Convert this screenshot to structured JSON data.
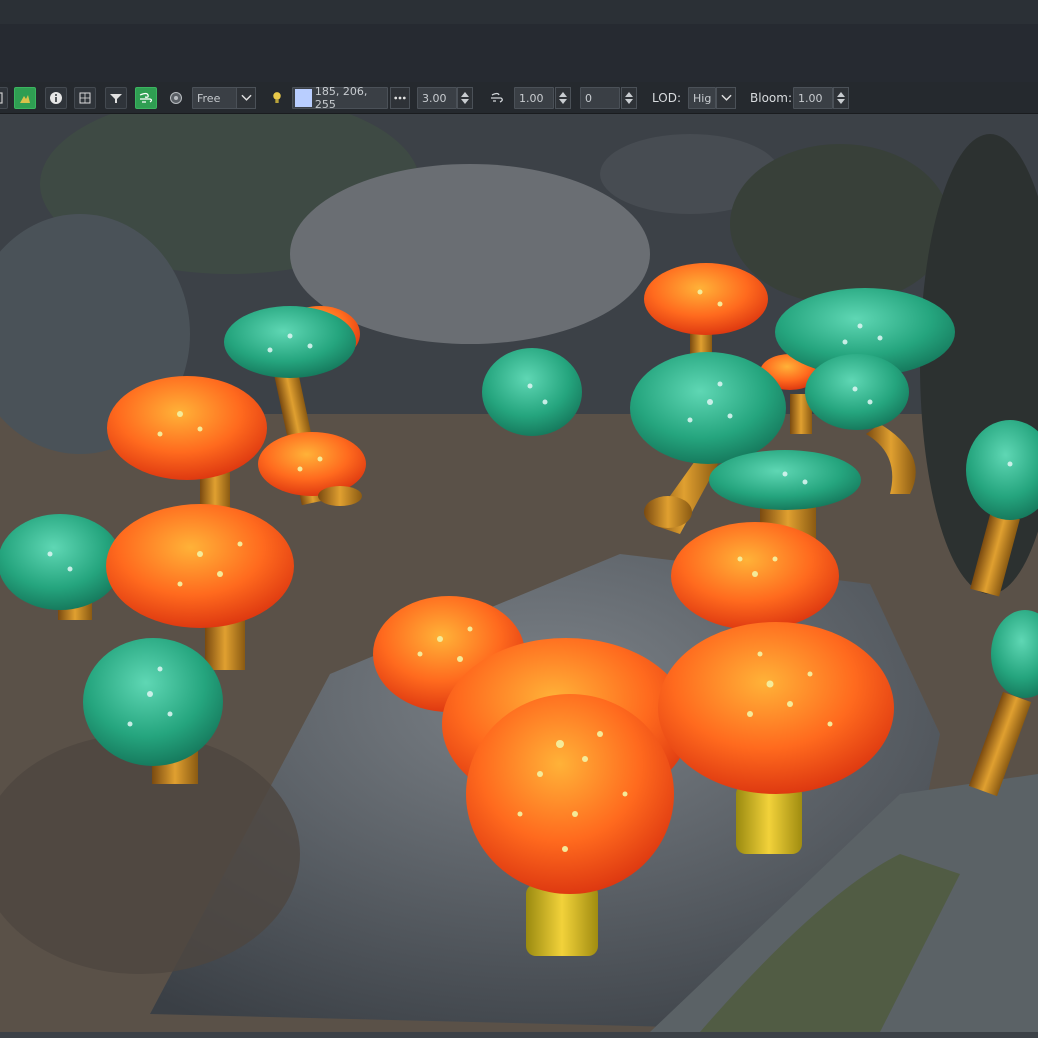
{
  "toolbar": {
    "mode_select": {
      "value": "Free"
    },
    "light_color": {
      "value": "185, 206, 255",
      "swatch": "#b9ceff"
    },
    "intensity": {
      "value": "3.00"
    },
    "wind_strength": {
      "value": "1.00"
    },
    "wind_offset": {
      "value": "0"
    },
    "lod": {
      "label": "LOD:",
      "value": "Hig"
    },
    "bloom": {
      "label": "Bloom:",
      "value": "1.00"
    }
  },
  "colors": {
    "accent_green": "#2f9e52",
    "toolbar_bg": "#25292e",
    "field_bg": "#3a3f45"
  },
  "icons": [
    "terrain-icon",
    "info-icon",
    "grid-icon",
    "filter-icon",
    "wind-icon",
    "globe-icon",
    "bulb-icon",
    "more-icon",
    "wind-small-icon"
  ]
}
